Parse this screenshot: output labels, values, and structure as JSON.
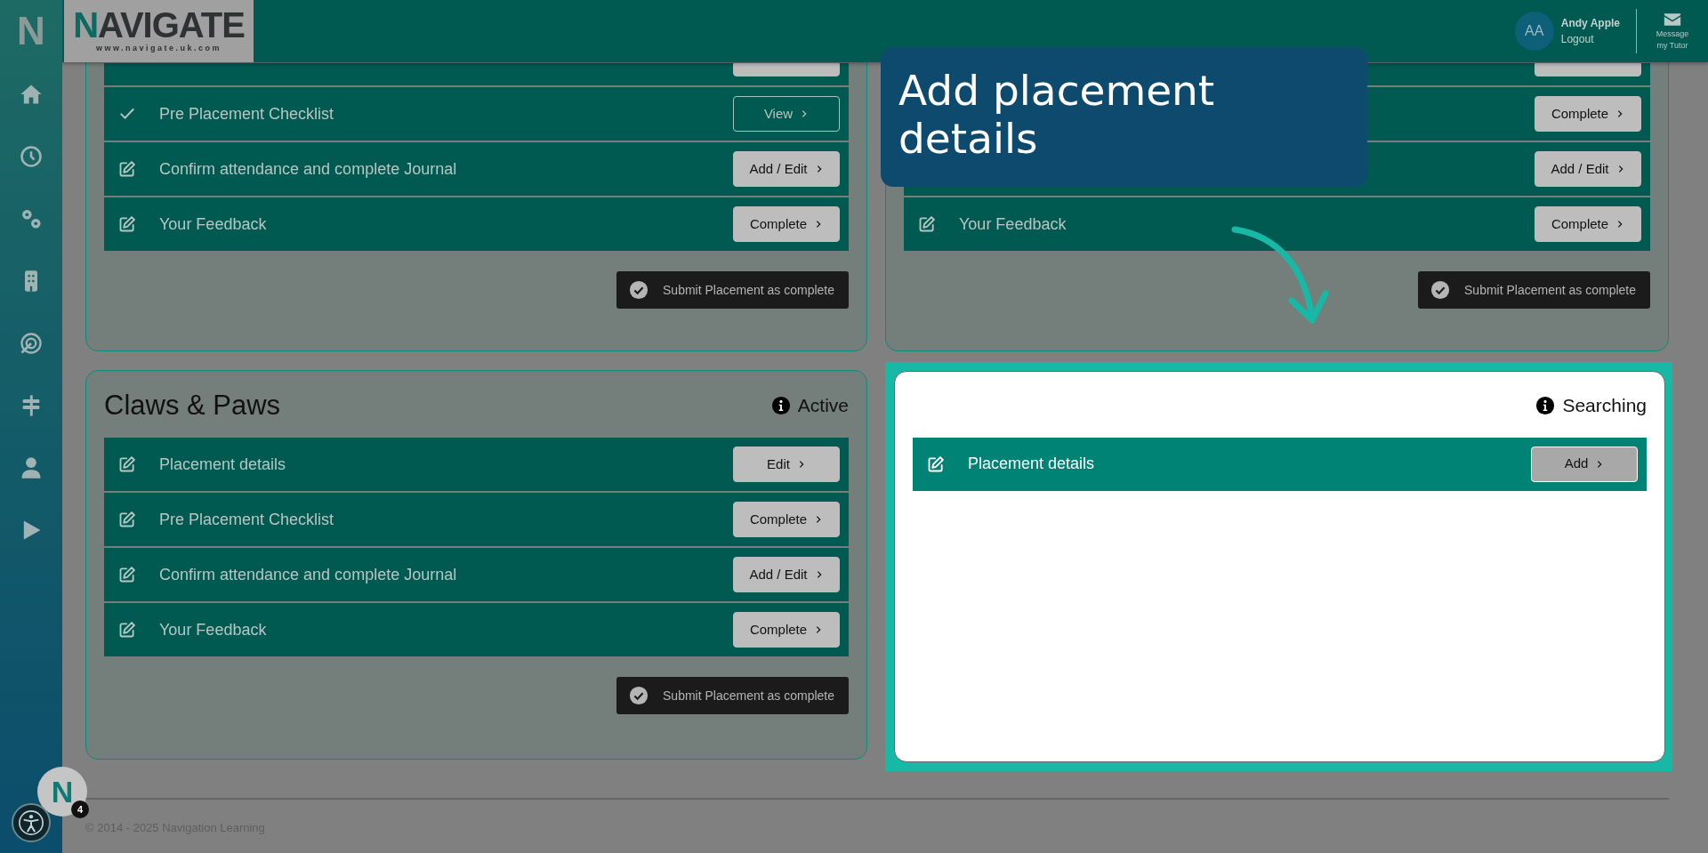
{
  "sidebar": {
    "logo": "N"
  },
  "header": {
    "logo_text": "NAVIGATE",
    "logo_url": "www.navigate.uk.com",
    "user": {
      "initials": "AA",
      "name": "Andy Apple",
      "logout": "Logout"
    },
    "message_button": "Message my Tutor"
  },
  "cards": [
    {
      "highlighted": false,
      "rows": [
        {
          "clipped": true,
          "done": false
        },
        {
          "done": true,
          "label": "Pre Placement Checklist",
          "button": "View"
        },
        {
          "done": false,
          "label": "Confirm attendance and complete Journal",
          "button": "Add / Edit"
        },
        {
          "done": false,
          "label": "Your Feedback",
          "button": "Complete"
        }
      ],
      "submit": "Submit Placement as complete"
    },
    {
      "highlighted": false,
      "rows": [
        {
          "clipped": true,
          "done": false
        },
        {
          "done": false,
          "button": "Complete"
        },
        {
          "done": false,
          "button": "Add / Edit"
        },
        {
          "done": false,
          "label": "Your Feedback",
          "button": "Complete"
        }
      ],
      "submit": "Submit Placement as complete"
    },
    {
      "highlighted": false,
      "title": "Claws & Paws",
      "status": "Active",
      "rows": [
        {
          "done": false,
          "label": "Placement details",
          "button": "Edit"
        },
        {
          "done": false,
          "label": "Pre Placement Checklist",
          "button": "Complete"
        },
        {
          "done": false,
          "label": "Confirm attendance and complete Journal",
          "button": "Add / Edit"
        },
        {
          "done": false,
          "label": "Your Feedback",
          "button": "Complete"
        }
      ],
      "submit": "Submit Placement as complete"
    },
    {
      "highlighted": true,
      "status": "Searching",
      "rows": [
        {
          "done": false,
          "label": "Placement details",
          "button": "Add"
        }
      ]
    }
  ],
  "callout": {
    "text": "Add placement details"
  },
  "footer": "© 2014 - 2025 Navigation Learning",
  "chat_widget": {
    "logo": "N",
    "badge": "4"
  }
}
